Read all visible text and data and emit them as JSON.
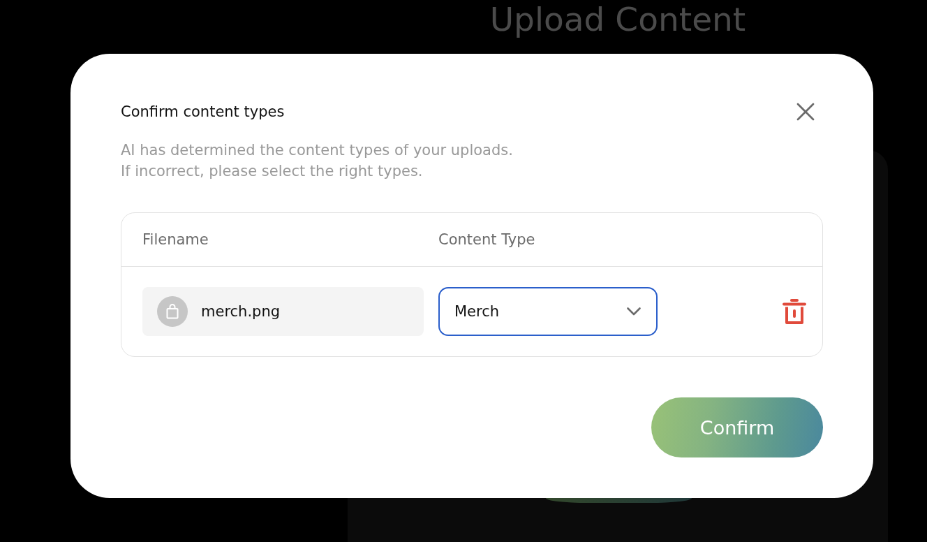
{
  "background": {
    "heading": "Upload Content"
  },
  "dialog": {
    "title": "Confirm content types",
    "description": [
      "AI has determined the content types of your uploads.",
      "If incorrect, please select the right types."
    ],
    "table": {
      "columns": [
        "Filename",
        "Content Type"
      ],
      "rows": [
        {
          "filename": "merch.png",
          "content_type": "Merch",
          "focused": true
        }
      ]
    },
    "buttons": [
      "Confirm"
    ]
  }
}
